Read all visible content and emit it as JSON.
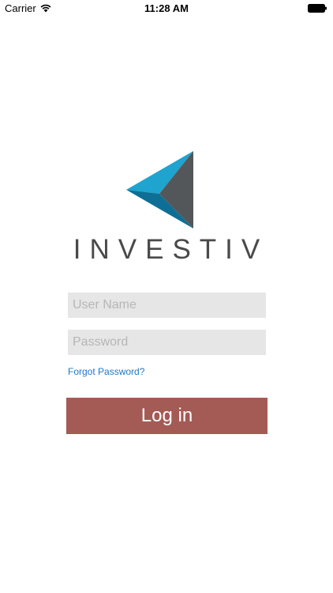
{
  "status_bar": {
    "carrier": "Carrier",
    "time": "11:28 AM",
    "wifi_icon": "wifi-icon",
    "battery_icon": "battery-icon"
  },
  "brand": {
    "name": "INVESTIV",
    "logo_icon": "investiv-logo-icon",
    "colors": {
      "blue_light": "#1fa3cf",
      "blue_dark": "#0e6f96",
      "gray": "#54575a"
    }
  },
  "login_form": {
    "username_placeholder": "User Name",
    "username_value": "",
    "password_placeholder": "Password",
    "password_value": "",
    "forgot_password_label": "Forgot Password?",
    "login_label": "Log in"
  },
  "colors": {
    "accent": "#a45a55",
    "link": "#2079c7",
    "field_background": "#e6e6e6"
  }
}
